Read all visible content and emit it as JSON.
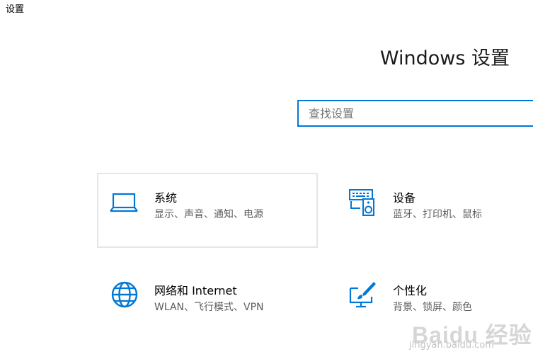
{
  "window": {
    "title": "设置"
  },
  "header": {
    "title": "Windows 设置"
  },
  "search": {
    "placeholder": "查找设置",
    "value": ""
  },
  "tiles": [
    {
      "title": "系统",
      "desc": "显示、声音、通知、电源",
      "icon": "laptop-icon"
    },
    {
      "title": "设备",
      "desc": "蓝牙、打印机、鼠标",
      "icon": "devices-icon"
    },
    {
      "title": "网络和 Internet",
      "desc": "WLAN、飞行模式、VPN",
      "icon": "globe-icon"
    },
    {
      "title": "个性化",
      "desc": "背景、锁屏、颜色",
      "icon": "personalization-icon"
    }
  ],
  "watermark": {
    "logo": "Baidu 经验",
    "url": "jingyan.baidu.com"
  },
  "colors": {
    "accent": "#0078d7",
    "tile_focus_border": "#e6e6e6",
    "desc_text": "#5d5d5d"
  }
}
